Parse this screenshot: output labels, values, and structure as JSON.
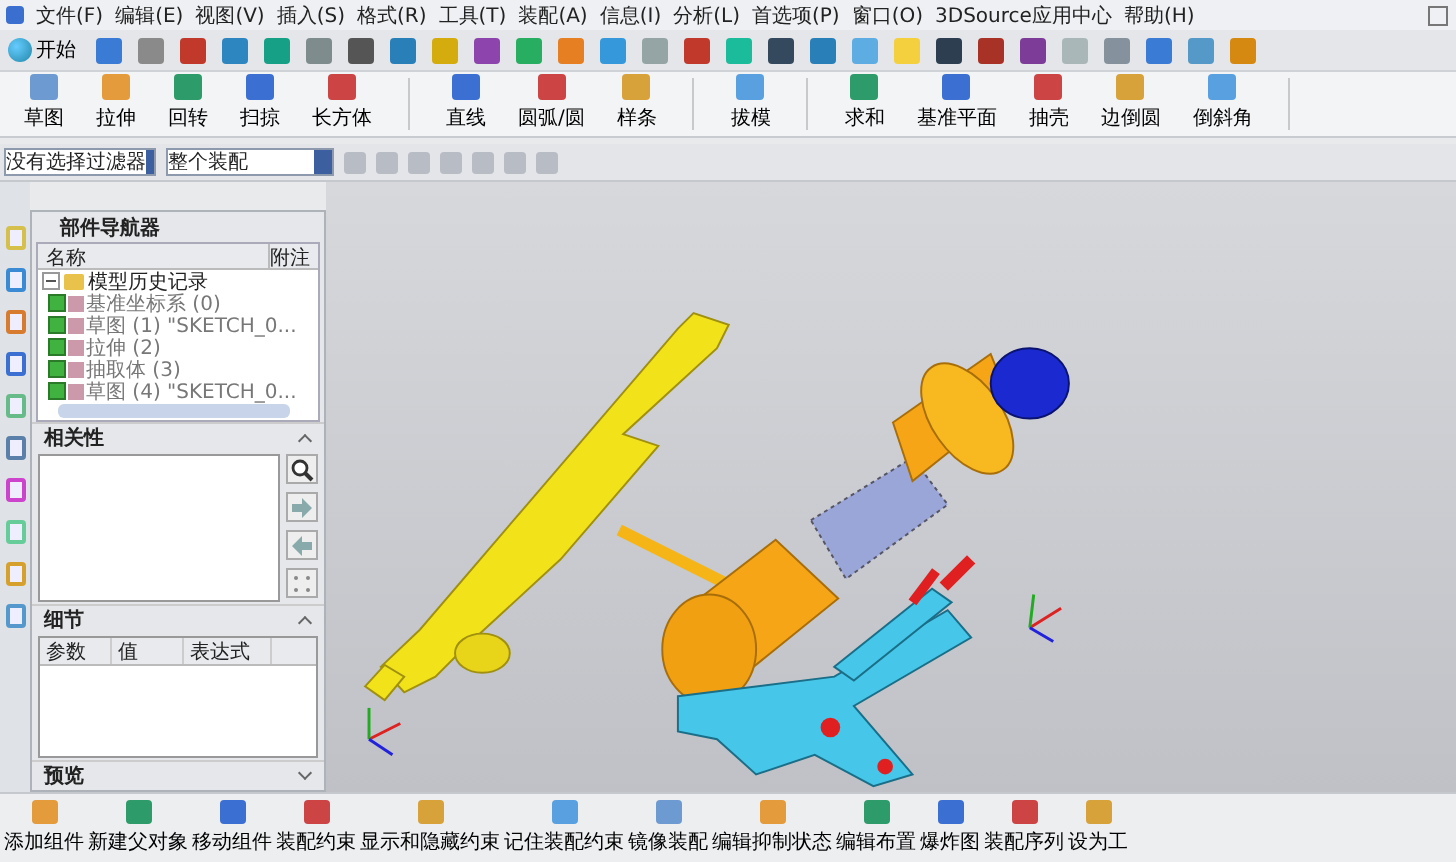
{
  "menu_bar": {
    "items": [
      "文件(F)",
      "编辑(E)",
      "视图(V)",
      "插入(S)",
      "格式(R)",
      "工具(T)",
      "装配(A)",
      "信息(I)",
      "分析(L)",
      "首选项(P)",
      "窗口(O)",
      "3DSource应用中心",
      "帮助(H)"
    ]
  },
  "standard_toolbar": {
    "start_label": "开始"
  },
  "ribbon": {
    "groups": [
      {
        "items": [
          "草图",
          "拉伸",
          "回转",
          "扫掠",
          "长方体"
        ]
      },
      {
        "items": [
          "直线",
          "圆弧/圆",
          "样条"
        ]
      },
      {
        "items": [
          "拔模"
        ]
      },
      {
        "items": [
          "求和",
          "基准平面",
          "抽壳",
          "边倒圆",
          "倒斜角"
        ]
      }
    ]
  },
  "selection_bar": {
    "filter": "没有选择过滤器",
    "scope": "整个装配"
  },
  "part_navigator": {
    "title": "部件导航器",
    "columns": [
      "名称",
      "附注"
    ],
    "tree": {
      "label": "模型历史记录",
      "expanded": true,
      "children": [
        {
          "label": "基准坐标系 (0)",
          "checked": true
        },
        {
          "label": "草图 (1) \"SKETCH_0...",
          "checked": true
        },
        {
          "label": "拉伸 (2)",
          "checked": true
        },
        {
          "label": "抽取体 (3)",
          "checked": true
        },
        {
          "label": "草图 (4) \"SKETCH_0...",
          "checked": true
        }
      ]
    }
  },
  "dependencies": {
    "title": "相关性",
    "expanded": true
  },
  "details": {
    "title": "细节",
    "expanded": true,
    "columns": [
      "参数",
      "值",
      "表达式"
    ]
  },
  "preview": {
    "title": "预览",
    "expanded": false
  },
  "assembly_toolbar": {
    "items": [
      "添加组件",
      "新建父对象",
      "移动组件",
      "装配约束",
      "显示和隐藏约束",
      "记住装配约束",
      "镜像装配",
      "编辑抑制状态",
      "编辑布置",
      "爆炸图",
      "装配序列",
      "设为工"
    ]
  }
}
